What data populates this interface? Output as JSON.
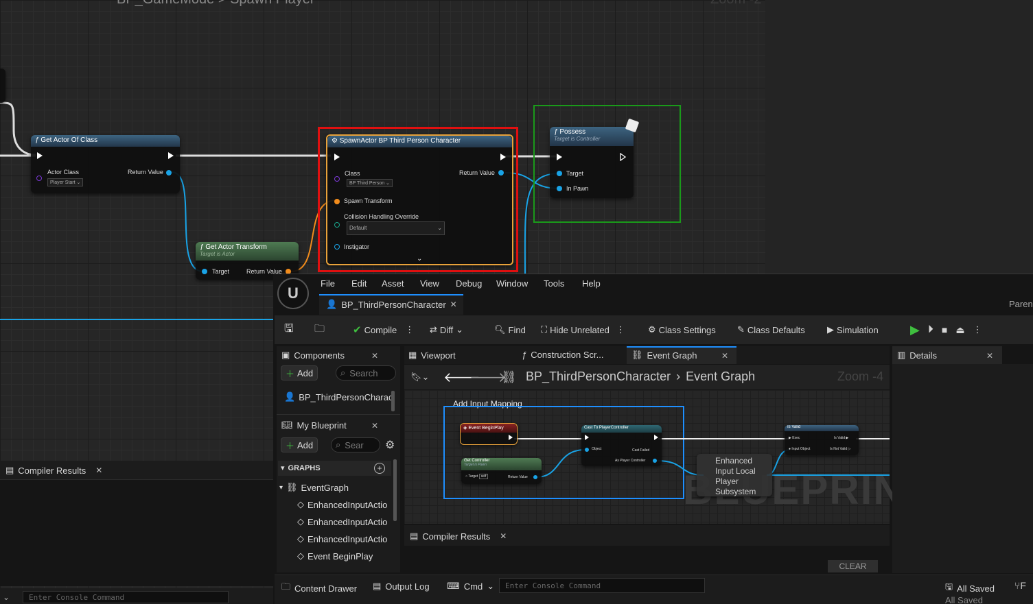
{
  "background_graph": {
    "breadcrumb": "BP_GameMode > Spawn Player",
    "zoom": "Zoom -2",
    "nodes": {
      "get_actor_of_class": {
        "title": "Get Actor Of Class",
        "in_label": "Actor Class",
        "in_value": "Player Start",
        "out_label": "Return Value"
      },
      "spawn_actor": {
        "title": "SpawnActor BP Third Person Character",
        "class_label": "Class",
        "class_value": "BP Third Person",
        "out_label": "Return Value",
        "transform_label": "Spawn Transform",
        "collision_label": "Collision Handling Override",
        "collision_value": "Default",
        "instigator_label": "Instigator"
      },
      "get_actor_transform": {
        "title": "Get Actor Transform",
        "subtitle": "Target is Actor",
        "target_label": "Target",
        "out_label": "Return Value"
      },
      "possess": {
        "title": "Possess",
        "subtitle": "Target is Controller",
        "target_label": "Target",
        "pawn_label": "In Pawn"
      }
    },
    "highlight_colors": {
      "spawn": "#e01010",
      "possess": "#1a9a1a"
    },
    "compiler_results_tab": "Compiler Results",
    "console_placeholder": "Enter Console Command"
  },
  "editor": {
    "menu": [
      "File",
      "Edit",
      "Asset",
      "View",
      "Debug",
      "Window",
      "Tools",
      "Help"
    ],
    "asset_tab": "BP_ThirdPersonCharacter",
    "parent_label": "Paren",
    "toolbar": {
      "compile": "Compile",
      "diff": "Diff",
      "find": "Find",
      "hide_unrelated": "Hide Unrelated",
      "class_settings": "Class Settings",
      "class_defaults": "Class Defaults",
      "simulation": "Simulation"
    },
    "components_panel": {
      "title": "Components",
      "add": "Add",
      "search_placeholder": "Search",
      "root_item": "BP_ThirdPersonCharac"
    },
    "my_blueprint_panel": {
      "title": "My Blueprint",
      "add": "Add",
      "search_placeholder": "Sear",
      "graphs_header": "GRAPHS",
      "event_graph": "EventGraph",
      "items": [
        "EnhancedInputActio",
        "EnhancedInputActio",
        "EnhancedInputActio",
        "Event BeginPlay"
      ]
    },
    "doc_tabs": {
      "viewport": "Viewport",
      "construction": "Construction Scr...",
      "event_graph": "Event Graph"
    },
    "graph": {
      "breadcrumb_root": "BP_ThirdPersonCharacter",
      "breadcrumb_leaf": "Event Graph",
      "zoom": "Zoom -4",
      "comment": "Add Input Mapping",
      "watermark": "BLUEPRINT",
      "nodes": {
        "begin_play": "Event BeginPlay",
        "cast": "Cast To PlayerController",
        "cast_object": "Object",
        "cast_failed": "Cast Failed",
        "as_pc": "As Player Controller",
        "get_controller": "Get Controller",
        "get_controller_sub": "Target is Pawn",
        "gc_target": "Target",
        "gc_self": "self",
        "gc_return": "Return Value",
        "is_valid": "Is Valid",
        "iv_exec": "Exec",
        "iv_is_valid": "Is Valid",
        "iv_input": "Input Object",
        "iv_not_valid": "Is Not Valid",
        "subsystem": "Enhanced Input Local Player Subsystem"
      }
    },
    "details_panel": {
      "title": "Details"
    },
    "compiler_results": {
      "title": "Compiler Results",
      "clear": "CLEAR"
    },
    "status_bar": {
      "content_drawer": "Content Drawer",
      "output_log": "Output Log",
      "cmd": "Cmd",
      "console_placeholder": "Enter Console Command",
      "all_saved": "All Saved",
      "all_saved_bg": "All Saved"
    }
  },
  "colors": {
    "accent_blue": "#1e8fff",
    "play_green": "#3fbf3f",
    "exec_white": "#ffffff",
    "data_blue": "#19a3e6",
    "transform_orange": "#f28c1c"
  }
}
